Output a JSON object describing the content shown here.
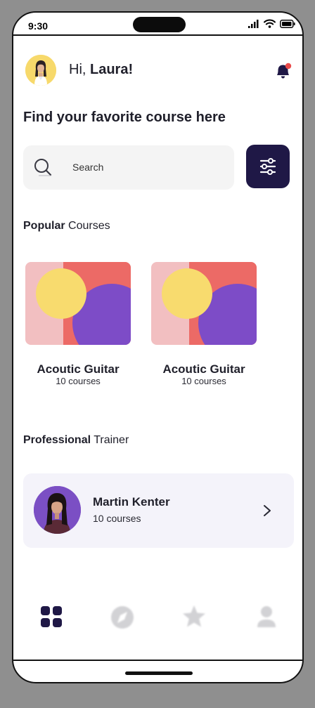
{
  "status_bar": {
    "time": "9:30",
    "icons": [
      "signal-icon",
      "wifi-icon",
      "battery-icon"
    ]
  },
  "header": {
    "greeting_prefix": "Hi, ",
    "user_name": "Laura!",
    "avatar_bg": "#F7D96B",
    "notification_icon": "bell-icon",
    "notification_dot_color": "#E94B4B"
  },
  "headline": "Find your favorite course here",
  "search": {
    "placeholder": "Search",
    "icon": "search-icon",
    "filter_icon": "sliders-icon"
  },
  "popular": {
    "title_bold": "Popular",
    "title_rest": " Courses",
    "courses": [
      {
        "title": "Acoutic Guitar",
        "count": "10 courses"
      },
      {
        "title": "Acoutic Guitar",
        "count": "10 courses"
      }
    ]
  },
  "trainers": {
    "title_bold": "Professional",
    "title_rest": " Trainer",
    "items": [
      {
        "name": "Martin Kenter",
        "count": "10 courses"
      }
    ]
  },
  "bottom_nav": [
    {
      "id": "home",
      "icon": "grid-icon",
      "active": true
    },
    {
      "id": "explore",
      "icon": "compass-icon",
      "active": false
    },
    {
      "id": "favorites",
      "icon": "star-icon",
      "active": false
    },
    {
      "id": "profile",
      "icon": "user-icon",
      "active": false
    }
  ],
  "colors": {
    "primary_dark": "#1F1846",
    "card_bg": "#F4F3FA",
    "search_bg": "#F4F4F4",
    "thumb_pink": "#F2BFC1",
    "thumb_coral": "#EC6A66",
    "thumb_yellow": "#F8DB6E",
    "thumb_purple": "#7D4CC7",
    "trainer_avatar_bg": "#7B4FC4"
  }
}
